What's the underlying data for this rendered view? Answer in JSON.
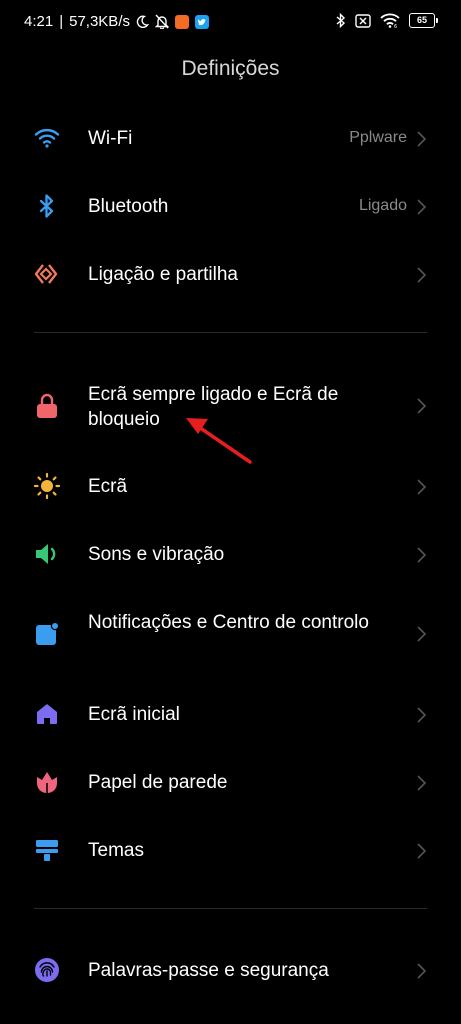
{
  "status_bar": {
    "time": "4:21",
    "separator": "|",
    "speed": "57,3KB/s",
    "battery": "65",
    "icons": [
      "moon-icon",
      "bell-muted-icon",
      "app-orange-icon",
      "twitter-icon",
      "bluetooth-icon",
      "sim-off-icon",
      "wifi-icon",
      "battery-icon"
    ]
  },
  "header": {
    "title": "Definições"
  },
  "settings": {
    "items": [
      {
        "label": "Wi-Fi",
        "value": "Pplware",
        "icon": "wifi-icon",
        "color": "#3a9df0"
      },
      {
        "label": "Bluetooth",
        "value": "Ligado",
        "icon": "bluetooth-icon",
        "color": "#3a9df0"
      },
      {
        "label": "Ligação e partilha",
        "value": "",
        "icon": "connection-share-icon",
        "color": "#f07a5a"
      },
      {
        "label": "Ecrã sempre ligado e Ecrã de bloqueio",
        "value": "",
        "icon": "lock-icon",
        "color": "#f0656a"
      },
      {
        "label": "Ecrã",
        "value": "",
        "icon": "sun-icon",
        "color": "#f3b43a"
      },
      {
        "label": "Sons e vibração",
        "value": "",
        "icon": "speaker-icon",
        "color": "#36c878"
      },
      {
        "label": "Notificações e Centro de controlo",
        "value": "",
        "icon": "notification-icon",
        "color": "#3a9df0"
      },
      {
        "label": "Ecrã inicial",
        "value": "",
        "icon": "home-icon",
        "color": "#7b6cf0"
      },
      {
        "label": "Papel de parede",
        "value": "",
        "icon": "flower-icon",
        "color": "#f0657e"
      },
      {
        "label": "Temas",
        "value": "",
        "icon": "paint-roller-icon",
        "color": "#3a9df0"
      },
      {
        "label": "Palavras-passe e segurança",
        "value": "",
        "icon": "fingerprint-icon",
        "color": "#7b6cf0"
      }
    ]
  },
  "annotation": {
    "arrow_color": "#e61e1e"
  }
}
